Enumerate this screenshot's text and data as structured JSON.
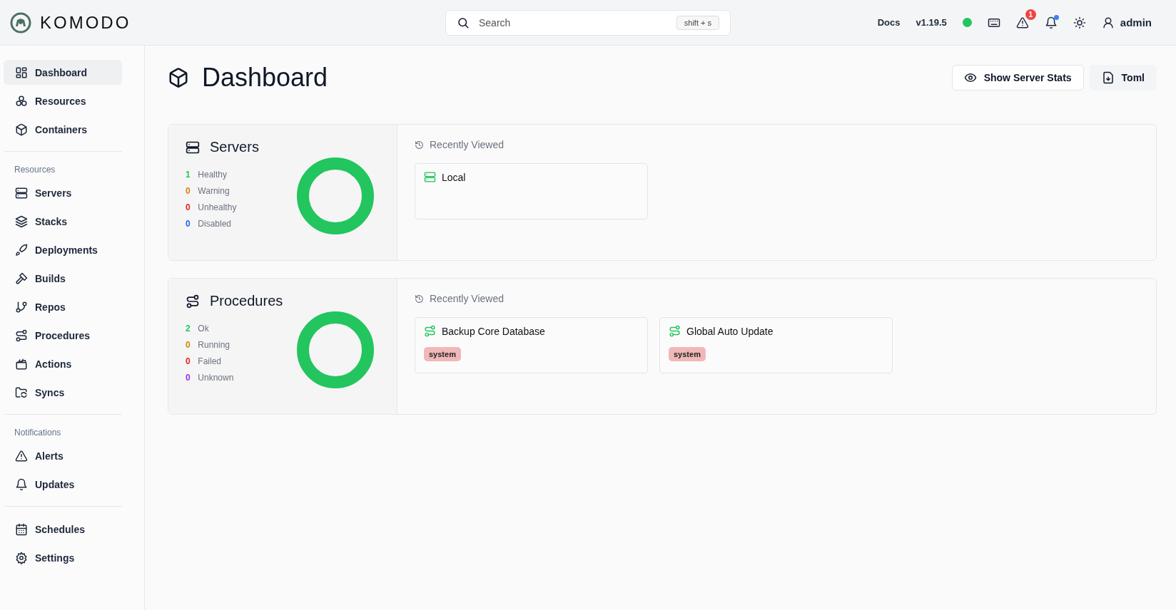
{
  "header": {
    "logo_text": "KOMODO",
    "search": {
      "placeholder": "Search",
      "shortcut": "shift + s"
    },
    "docs_link": "Docs",
    "version": "v1.19.5",
    "connected": true,
    "alerts_badge": "1",
    "updates_unread": true,
    "user": "admin"
  },
  "sidebar": {
    "sections": [
      {
        "items": [
          {
            "label": "Dashboard",
            "selected": true
          },
          {
            "label": "Resources",
            "selected": false
          },
          {
            "label": "Containers",
            "selected": false
          }
        ]
      },
      {
        "heading": "Resources",
        "items": [
          {
            "label": "Servers",
            "selected": false
          },
          {
            "label": "Stacks",
            "selected": false
          },
          {
            "label": "Deployments",
            "selected": false
          },
          {
            "label": "Builds",
            "selected": false
          },
          {
            "label": "Repos",
            "selected": false
          },
          {
            "label": "Procedures",
            "selected": false
          },
          {
            "label": "Actions",
            "selected": false
          },
          {
            "label": "Syncs",
            "selected": false
          }
        ]
      },
      {
        "heading": "Notifications",
        "items": [
          {
            "label": "Alerts",
            "selected": false
          },
          {
            "label": "Updates",
            "selected": false
          }
        ]
      },
      {
        "items": [
          {
            "label": "Schedules",
            "selected": false
          },
          {
            "label": "Settings",
            "selected": false
          }
        ]
      }
    ]
  },
  "page": {
    "title": "Dashboard",
    "buttons": [
      "Show Server Stats",
      "Toml"
    ]
  },
  "panels": [
    {
      "kind": "servers",
      "title": "Servers",
      "stats": [
        {
          "count": "1",
          "label": "Healthy",
          "color": "#22c55e"
        },
        {
          "count": "0",
          "label": "Warning",
          "color": "#ca8a04"
        },
        {
          "count": "0",
          "label": "Unhealthy",
          "color": "#dc2626"
        },
        {
          "count": "0",
          "label": "Disabled",
          "color": "#2563eb"
        }
      ],
      "recent_label": "Recently Viewed",
      "recent": [
        {
          "name": "Local"
        }
      ]
    },
    {
      "kind": "procedures",
      "title": "Procedures",
      "stats": [
        {
          "count": "2",
          "label": "Ok",
          "color": "#22c55e"
        },
        {
          "count": "0",
          "label": "Running",
          "color": "#ca8a04"
        },
        {
          "count": "0",
          "label": "Failed",
          "color": "#dc2626"
        },
        {
          "count": "0",
          "label": "Unknown",
          "color": "#9333ea"
        }
      ],
      "recent_label": "Recently Viewed",
      "recent": [
        {
          "name": "Backup Core Database",
          "tags": [
            "system"
          ]
        },
        {
          "name": "Global Auto Update",
          "tags": [
            "system"
          ]
        }
      ]
    }
  ]
}
